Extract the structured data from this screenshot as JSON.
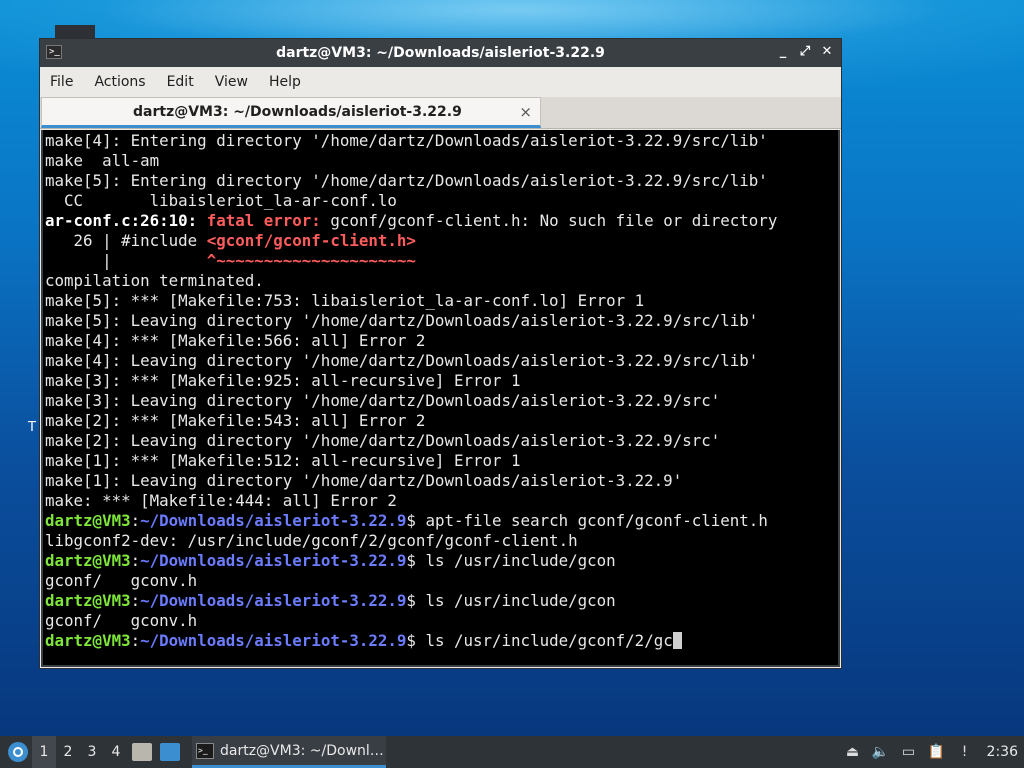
{
  "desktop": {
    "side_text": "T"
  },
  "window": {
    "title": "dartz@VM3: ~/Downloads/aisleriot-3.22.9",
    "controls": {
      "minimize": "_",
      "maximize": "⤢",
      "close": "✕"
    },
    "menu": [
      "File",
      "Actions",
      "Edit",
      "View",
      "Help"
    ],
    "tab": {
      "title": "dartz@VM3: ~/Downloads/aisleriot-3.22.9",
      "close": "×"
    }
  },
  "terminal": {
    "prompt_user": "dartz@VM3",
    "prompt_path": "~/Downloads/aisleriot-3.22.9",
    "lines": [
      "make[4]: Entering directory '/home/dartz/Downloads/aisleriot-3.22.9/src/lib'",
      "make  all-am",
      "make[5]: Entering directory '/home/dartz/Downloads/aisleriot-3.22.9/src/lib'",
      "  CC       libaisleriot_la-ar-conf.lo",
      "ar-conf.c:26:10: fatal error: gconf/gconf-client.h: No such file or directory",
      "   26 | #include <gconf/gconf-client.h>",
      "      |          ^~~~~~~~~~~~~~~~~~~~~~",
      "compilation terminated.",
      "make[5]: *** [Makefile:753: libaisleriot_la-ar-conf.lo] Error 1",
      "make[5]: Leaving directory '/home/dartz/Downloads/aisleriot-3.22.9/src/lib'",
      "make[4]: *** [Makefile:566: all] Error 2",
      "make[4]: Leaving directory '/home/dartz/Downloads/aisleriot-3.22.9/src/lib'",
      "make[3]: *** [Makefile:925: all-recursive] Error 1",
      "make[3]: Leaving directory '/home/dartz/Downloads/aisleriot-3.22.9/src'",
      "make[2]: *** [Makefile:543: all] Error 2",
      "make[2]: Leaving directory '/home/dartz/Downloads/aisleriot-3.22.9/src'",
      "make[1]: *** [Makefile:512: all-recursive] Error 1",
      "make[1]: Leaving directory '/home/dartz/Downloads/aisleriot-3.22.9'",
      "make: *** [Makefile:444: all] Error 2",
      "dartz@VM3:~/Downloads/aisleriot-3.22.9$ apt-file search gconf/gconf-client.h",
      "libgconf2-dev: /usr/include/gconf/2/gconf/gconf-client.h",
      "dartz@VM3:~/Downloads/aisleriot-3.22.9$ ls /usr/include/gcon",
      "gconf/   gconv.h",
      "dartz@VM3:~/Downloads/aisleriot-3.22.9$ ls /usr/include/gcon",
      "gconf/   gconv.h",
      "dartz@VM3:~/Downloads/aisleriot-3.22.9$ ls /usr/include/gconf/2/gc"
    ],
    "error_parts": {
      "location": "ar-conf.c:26:10:",
      "label": "fatal error:",
      "message": " gconf/gconf-client.h: No such file or directory",
      "include_prefix": "   26 | #include ",
      "include_file": "<gconf/gconf-client.h>",
      "caret_prefix": "      |          ",
      "caret": "^~~~~~~~~~~~~~~~~~~~~~"
    },
    "commands": [
      " apt-file search gconf/gconf-client.h",
      " ls /usr/include/gcon",
      " ls /usr/include/gcon",
      " ls /usr/include/gconf/2/gc"
    ]
  },
  "taskbar": {
    "workspaces": [
      "1",
      "2",
      "3",
      "4"
    ],
    "active_workspace": "1",
    "task_label": "dartz@VM3: ~/Downl…",
    "clock": "2:36",
    "tray_icons": [
      "eject-icon",
      "volume-icon",
      "network-icon",
      "clipboard-icon",
      "update-icon"
    ]
  },
  "colors": {
    "prompt_user": "#7ee53a",
    "prompt_path": "#6b7cff",
    "error": "#ff5c5c",
    "accent": "#3b8fd0"
  }
}
